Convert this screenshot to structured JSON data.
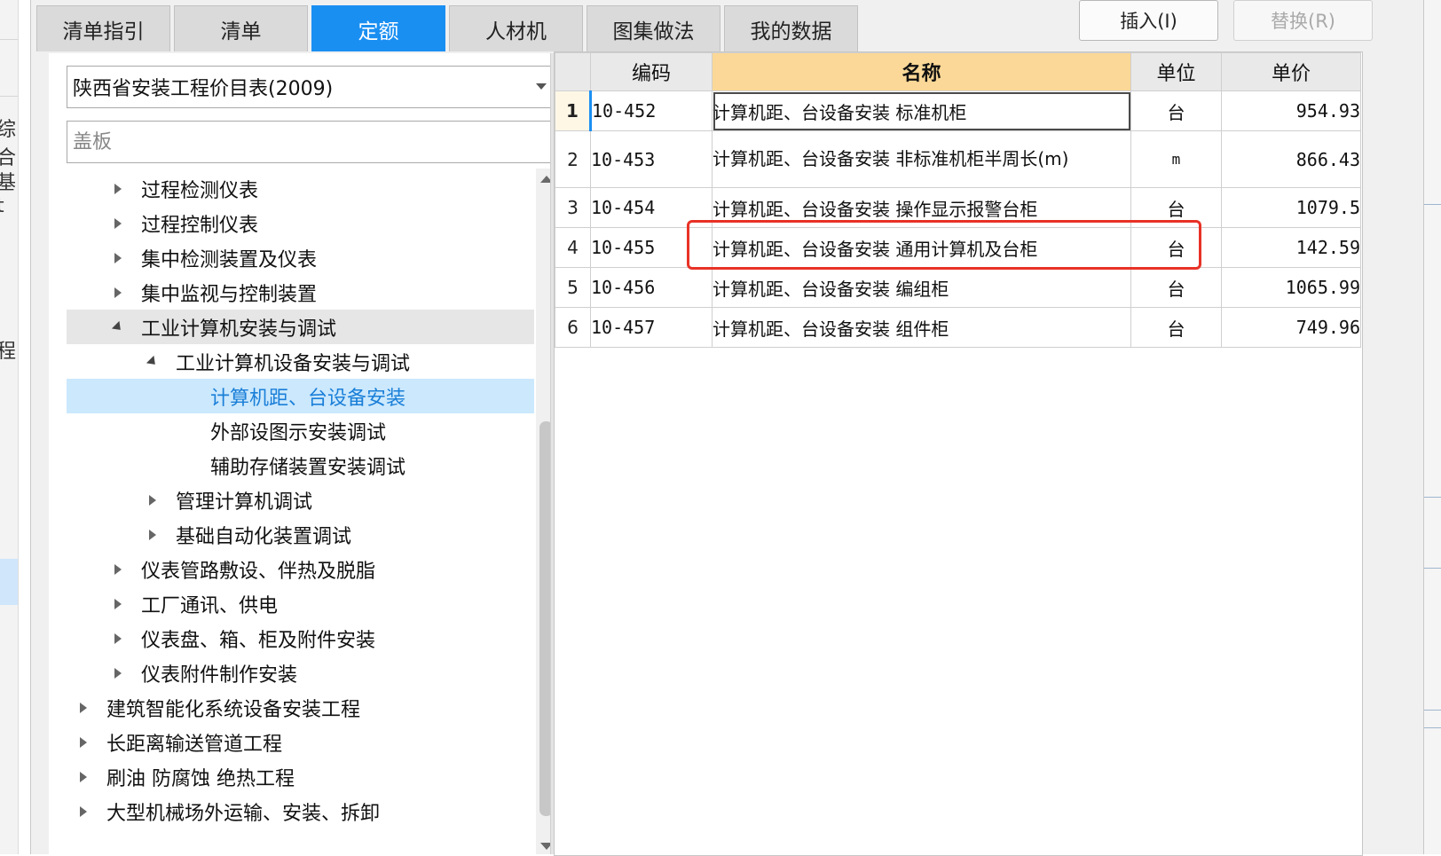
{
  "left_edge_fragments": [
    "综合",
    "基t",
    "程"
  ],
  "tabs": [
    {
      "label": "清单指引",
      "active": false
    },
    {
      "label": "清单",
      "active": false
    },
    {
      "label": "定额",
      "active": true
    },
    {
      "label": "人材机",
      "active": false
    },
    {
      "label": "图集做法",
      "active": false
    },
    {
      "label": "我的数据",
      "active": false
    }
  ],
  "buttons": {
    "insert": "插入(I)",
    "replace": "替换(R)"
  },
  "catalog": {
    "selected": "陕西省安装工程价目表(2009)"
  },
  "search": {
    "placeholder": "盖板"
  },
  "tree": [
    {
      "label": "过程检测仪表",
      "level": 1,
      "state": "collapsed"
    },
    {
      "label": "过程控制仪表",
      "level": 1,
      "state": "collapsed"
    },
    {
      "label": "集中检测装置及仪表",
      "level": 1,
      "state": "collapsed"
    },
    {
      "label": "集中监视与控制装置",
      "level": 1,
      "state": "collapsed"
    },
    {
      "label": "工业计算机安装与调试",
      "level": 1,
      "state": "expanded"
    },
    {
      "label": "工业计算机设备安装与调试",
      "level": 2,
      "state": "expanded"
    },
    {
      "label": "计算机距、台设备安装",
      "level": 3,
      "state": "leaf",
      "selected": true
    },
    {
      "label": "外部设图示安装调试",
      "level": 3,
      "state": "leaf"
    },
    {
      "label": "辅助存储装置安装调试",
      "level": 3,
      "state": "leaf"
    },
    {
      "label": "管理计算机调试",
      "level": 2,
      "state": "collapsed"
    },
    {
      "label": "基础自动化装置调试",
      "level": 2,
      "state": "collapsed"
    },
    {
      "label": "仪表管路敷设、伴热及脱脂",
      "level": 1,
      "state": "collapsed"
    },
    {
      "label": "工厂通讯、供电",
      "level": 1,
      "state": "collapsed"
    },
    {
      "label": "仪表盘、箱、柜及附件安装",
      "level": 1,
      "state": "collapsed"
    },
    {
      "label": "仪表附件制作安装",
      "level": 1,
      "state": "collapsed"
    },
    {
      "label": "建筑智能化系统设备安装工程",
      "level": 0,
      "state": "collapsed"
    },
    {
      "label": "长距离输送管道工程",
      "level": 0,
      "state": "collapsed"
    },
    {
      "label": "刷油 防腐蚀 绝热工程",
      "level": 0,
      "state": "collapsed"
    },
    {
      "label": "大型机械场外运输、安装、拆卸",
      "level": 0,
      "state": "collapsed"
    }
  ],
  "grid": {
    "headers": {
      "code": "编码",
      "name": "名称",
      "unit": "单位",
      "price": "单价"
    },
    "rows": [
      {
        "no": "1",
        "code": "10-452",
        "name": "计算机距、台设备安装 标准机柜",
        "unit": "台",
        "price": "954.93"
      },
      {
        "no": "2",
        "code": "10-453",
        "name": "计算机距、台设备安装 非标准机柜半周长(m)",
        "unit": "m",
        "price": "866.43"
      },
      {
        "no": "3",
        "code": "10-454",
        "name": "计算机距、台设备安装 操作显示报警台柜",
        "unit": "台",
        "price": "1079.5"
      },
      {
        "no": "4",
        "code": "10-455",
        "name": "计算机距、台设备安装 通用计算机及台柜",
        "unit": "台",
        "price": "142.59"
      },
      {
        "no": "5",
        "code": "10-456",
        "name": "计算机距、台设备安装 编组柜",
        "unit": "台",
        "price": "1065.99"
      },
      {
        "no": "6",
        "code": "10-457",
        "name": "计算机距、台设备安装 组件柜",
        "unit": "台",
        "price": "749.96"
      }
    ],
    "current_row": 1,
    "highlighted_row": 4
  },
  "colors": {
    "tab_active": "#1a8ff2",
    "header_name": "#fbd897",
    "selection": "#cbe8fd",
    "highlight_box": "#e83227"
  }
}
